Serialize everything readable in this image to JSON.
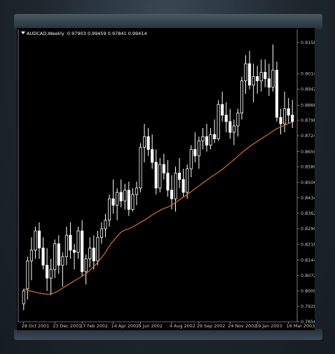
{
  "chart_header": {
    "symbol_timeframe": "AUDCAD,Weekly",
    "ohlc": "0.97903 0.99459 0.97841 0.99414"
  },
  "colors": {
    "background": "#000000",
    "candle": "#ffffff",
    "moving_average": "#d4702a",
    "axis": "#c8c8c8",
    "frame": "#1e262e"
  },
  "chart_data": {
    "type": "candlestick",
    "title": "",
    "x_tick_labels": [
      "28 Oct 2001",
      "23 Dec 2001",
      "17 Feb 2002",
      "14 Apr 2002",
      "9 Jun 2002",
      "4 Aug 2002",
      "29 Sep 2002",
      "24 Nov 2002",
      "19 Jan 2003",
      "16 Mar 2003"
    ],
    "y_tick_labels": [
      "0.91580",
      "0.90140",
      "0.89420",
      "0.88660",
      "0.87960",
      "0.87240",
      "0.86500",
      "0.85800",
      "0.85060",
      "0.84340",
      "0.83620",
      "0.82900",
      "0.82180",
      "0.81440",
      "0.80720",
      "0.80000",
      "0.79280",
      "0.78560"
    ],
    "ylim": [
      0.7856,
      0.9194
    ],
    "grid": false,
    "indicator": "moving average",
    "candles": [
      {
        "o": 0.794,
        "h": 0.801,
        "l": 0.791,
        "c": 0.8
      },
      {
        "o": 0.801,
        "h": 0.816,
        "l": 0.796,
        "c": 0.814
      },
      {
        "o": 0.814,
        "h": 0.825,
        "l": 0.805,
        "c": 0.819
      },
      {
        "o": 0.819,
        "h": 0.83,
        "l": 0.815,
        "c": 0.828
      },
      {
        "o": 0.828,
        "h": 0.832,
        "l": 0.815,
        "c": 0.82
      },
      {
        "o": 0.82,
        "h": 0.825,
        "l": 0.81,
        "c": 0.812
      },
      {
        "o": 0.812,
        "h": 0.82,
        "l": 0.8,
        "c": 0.806
      },
      {
        "o": 0.806,
        "h": 0.815,
        "l": 0.798,
        "c": 0.81
      },
      {
        "o": 0.81,
        "h": 0.824,
        "l": 0.806,
        "c": 0.822
      },
      {
        "o": 0.822,
        "h": 0.826,
        "l": 0.808,
        "c": 0.812
      },
      {
        "o": 0.812,
        "h": 0.818,
        "l": 0.802,
        "c": 0.816
      },
      {
        "o": 0.816,
        "h": 0.83,
        "l": 0.812,
        "c": 0.826
      },
      {
        "o": 0.826,
        "h": 0.832,
        "l": 0.815,
        "c": 0.819
      },
      {
        "o": 0.819,
        "h": 0.822,
        "l": 0.81,
        "c": 0.818
      },
      {
        "o": 0.818,
        "h": 0.83,
        "l": 0.815,
        "c": 0.828
      },
      {
        "o": 0.828,
        "h": 0.833,
        "l": 0.807,
        "c": 0.809
      },
      {
        "o": 0.809,
        "h": 0.817,
        "l": 0.803,
        "c": 0.815
      },
      {
        "o": 0.815,
        "h": 0.825,
        "l": 0.811,
        "c": 0.82
      },
      {
        "o": 0.82,
        "h": 0.826,
        "l": 0.81,
        "c": 0.814
      },
      {
        "o": 0.814,
        "h": 0.828,
        "l": 0.812,
        "c": 0.825
      },
      {
        "o": 0.825,
        "h": 0.832,
        "l": 0.822,
        "c": 0.829
      },
      {
        "o": 0.829,
        "h": 0.836,
        "l": 0.825,
        "c": 0.833
      },
      {
        "o": 0.833,
        "h": 0.845,
        "l": 0.83,
        "c": 0.843
      },
      {
        "o": 0.843,
        "h": 0.852,
        "l": 0.836,
        "c": 0.84
      },
      {
        "o": 0.84,
        "h": 0.848,
        "l": 0.833,
        "c": 0.846
      },
      {
        "o": 0.846,
        "h": 0.852,
        "l": 0.839,
        "c": 0.842
      },
      {
        "o": 0.842,
        "h": 0.85,
        "l": 0.838,
        "c": 0.847
      },
      {
        "o": 0.847,
        "h": 0.851,
        "l": 0.835,
        "c": 0.838
      },
      {
        "o": 0.838,
        "h": 0.848,
        "l": 0.837,
        "c": 0.845
      },
      {
        "o": 0.845,
        "h": 0.851,
        "l": 0.84,
        "c": 0.848
      },
      {
        "o": 0.848,
        "h": 0.869,
        "l": 0.846,
        "c": 0.867
      },
      {
        "o": 0.867,
        "h": 0.878,
        "l": 0.86,
        "c": 0.872
      },
      {
        "o": 0.872,
        "h": 0.876,
        "l": 0.863,
        "c": 0.866
      },
      {
        "o": 0.866,
        "h": 0.873,
        "l": 0.857,
        "c": 0.86
      },
      {
        "o": 0.86,
        "h": 0.866,
        "l": 0.845,
        "c": 0.848
      },
      {
        "o": 0.848,
        "h": 0.862,
        "l": 0.846,
        "c": 0.859
      },
      {
        "o": 0.859,
        "h": 0.864,
        "l": 0.852,
        "c": 0.855
      },
      {
        "o": 0.855,
        "h": 0.861,
        "l": 0.844,
        "c": 0.847
      },
      {
        "o": 0.847,
        "h": 0.854,
        "l": 0.838,
        "c": 0.843
      },
      {
        "o": 0.843,
        "h": 0.858,
        "l": 0.837,
        "c": 0.855
      },
      {
        "o": 0.855,
        "h": 0.862,
        "l": 0.848,
        "c": 0.852
      },
      {
        "o": 0.852,
        "h": 0.857,
        "l": 0.844,
        "c": 0.846
      },
      {
        "o": 0.846,
        "h": 0.859,
        "l": 0.843,
        "c": 0.857
      },
      {
        "o": 0.857,
        "h": 0.868,
        "l": 0.853,
        "c": 0.866
      },
      {
        "o": 0.866,
        "h": 0.874,
        "l": 0.86,
        "c": 0.863
      },
      {
        "o": 0.863,
        "h": 0.872,
        "l": 0.857,
        "c": 0.87
      },
      {
        "o": 0.87,
        "h": 0.876,
        "l": 0.866,
        "c": 0.872
      },
      {
        "o": 0.872,
        "h": 0.878,
        "l": 0.865,
        "c": 0.868
      },
      {
        "o": 0.868,
        "h": 0.876,
        "l": 0.866,
        "c": 0.873
      },
      {
        "o": 0.873,
        "h": 0.88,
        "l": 0.869,
        "c": 0.871
      },
      {
        "o": 0.871,
        "h": 0.889,
        "l": 0.87,
        "c": 0.887
      },
      {
        "o": 0.887,
        "h": 0.893,
        "l": 0.879,
        "c": 0.882
      },
      {
        "o": 0.882,
        "h": 0.888,
        "l": 0.874,
        "c": 0.879
      },
      {
        "o": 0.879,
        "h": 0.885,
        "l": 0.871,
        "c": 0.874
      },
      {
        "o": 0.874,
        "h": 0.88,
        "l": 0.868,
        "c": 0.877
      },
      {
        "o": 0.877,
        "h": 0.885,
        "l": 0.872,
        "c": 0.883
      },
      {
        "o": 0.883,
        "h": 0.9,
        "l": 0.88,
        "c": 0.898
      },
      {
        "o": 0.898,
        "h": 0.91,
        "l": 0.892,
        "c": 0.906
      },
      {
        "o": 0.906,
        "h": 0.912,
        "l": 0.894,
        "c": 0.896
      },
      {
        "o": 0.896,
        "h": 0.906,
        "l": 0.888,
        "c": 0.9
      },
      {
        "o": 0.9,
        "h": 0.905,
        "l": 0.892,
        "c": 0.898
      },
      {
        "o": 0.898,
        "h": 0.908,
        "l": 0.893,
        "c": 0.902
      },
      {
        "o": 0.902,
        "h": 0.908,
        "l": 0.895,
        "c": 0.899
      },
      {
        "o": 0.899,
        "h": 0.906,
        "l": 0.891,
        "c": 0.895
      },
      {
        "o": 0.895,
        "h": 0.915,
        "l": 0.893,
        "c": 0.903
      },
      {
        "o": 0.903,
        "h": 0.907,
        "l": 0.879,
        "c": 0.881
      },
      {
        "o": 0.881,
        "h": 0.885,
        "l": 0.873,
        "c": 0.878
      },
      {
        "o": 0.878,
        "h": 0.893,
        "l": 0.874,
        "c": 0.885
      },
      {
        "o": 0.885,
        "h": 0.89,
        "l": 0.878,
        "c": 0.882
      },
      {
        "o": 0.882,
        "h": 0.889,
        "l": 0.876,
        "c": 0.879
      }
    ],
    "moving_average": [
      0.801,
      0.8003,
      0.7998,
      0.7994,
      0.799,
      0.7987,
      0.7985,
      0.7986,
      0.7992,
      0.8001,
      0.8013,
      0.8025,
      0.8036,
      0.8047,
      0.8058,
      0.8068,
      0.808,
      0.8096,
      0.8114,
      0.8133,
      0.8155,
      0.818,
      0.821,
      0.8233,
      0.8255,
      0.8274,
      0.8284,
      0.829,
      0.8299,
      0.8309,
      0.832,
      0.833,
      0.8342,
      0.8355,
      0.8365,
      0.8376,
      0.8385,
      0.8391,
      0.84,
      0.8413,
      0.8425,
      0.8438,
      0.845,
      0.8463,
      0.8477,
      0.849,
      0.8504,
      0.8517,
      0.853,
      0.8542,
      0.8554,
      0.8567,
      0.8582,
      0.8597,
      0.8612,
      0.8628,
      0.8645,
      0.8659,
      0.8673,
      0.8686,
      0.8698,
      0.871,
      0.8722,
      0.8733,
      0.8745,
      0.8757,
      0.8765,
      0.8773,
      0.8781,
      0.8788
    ]
  }
}
